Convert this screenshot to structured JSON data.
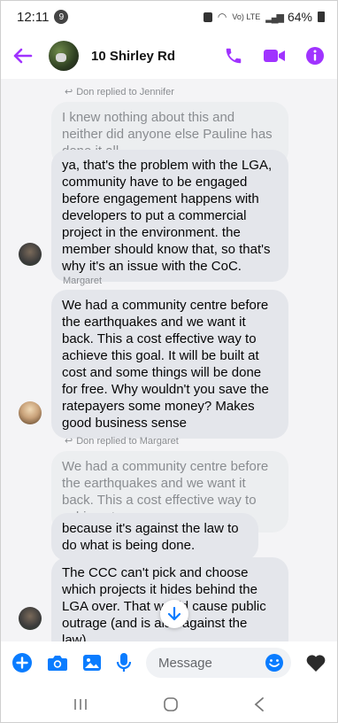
{
  "status_bar": {
    "time": "12:11",
    "notification_count": "9",
    "volte": "Vo) LTE",
    "battery": "64%"
  },
  "header": {
    "title": "10 Shirley Rd"
  },
  "messages": [
    {
      "reply_note": "Don replied to Jennifer",
      "quoted": "I knew nothing about this and neither did anyone else Pauline has done it all"
    },
    {
      "text": "ya, that's the problem with the LGA, community have to be engaged before engagement happens with developers to put a commercial project in the environment.  the member should know that, so that's why it's an issue with the CoC."
    },
    {
      "sender": "Margaret",
      "text": "We had a community centre before the earthquakes and we want it back. This a cost effective way to achieve this goal.  It will be built at cost and some things will be done for free. Why wouldn't you save the ratepayers some money? Makes good business sense"
    },
    {
      "reply_note": "Don replied to Margaret",
      "quoted": "We had a community centre before the earthquakes and we want it back. This a cost effective way to achieve t..."
    },
    {
      "text": "because it's against the law to do what is being done."
    },
    {
      "text": "The CCC can't pick and choose which projects it hides behind the LGA over. That would cause public outrage (and is also against the law)."
    }
  ],
  "composer": {
    "placeholder": "Message"
  },
  "colors": {
    "accent": "#a033ff",
    "blue": "#0a7cff"
  }
}
